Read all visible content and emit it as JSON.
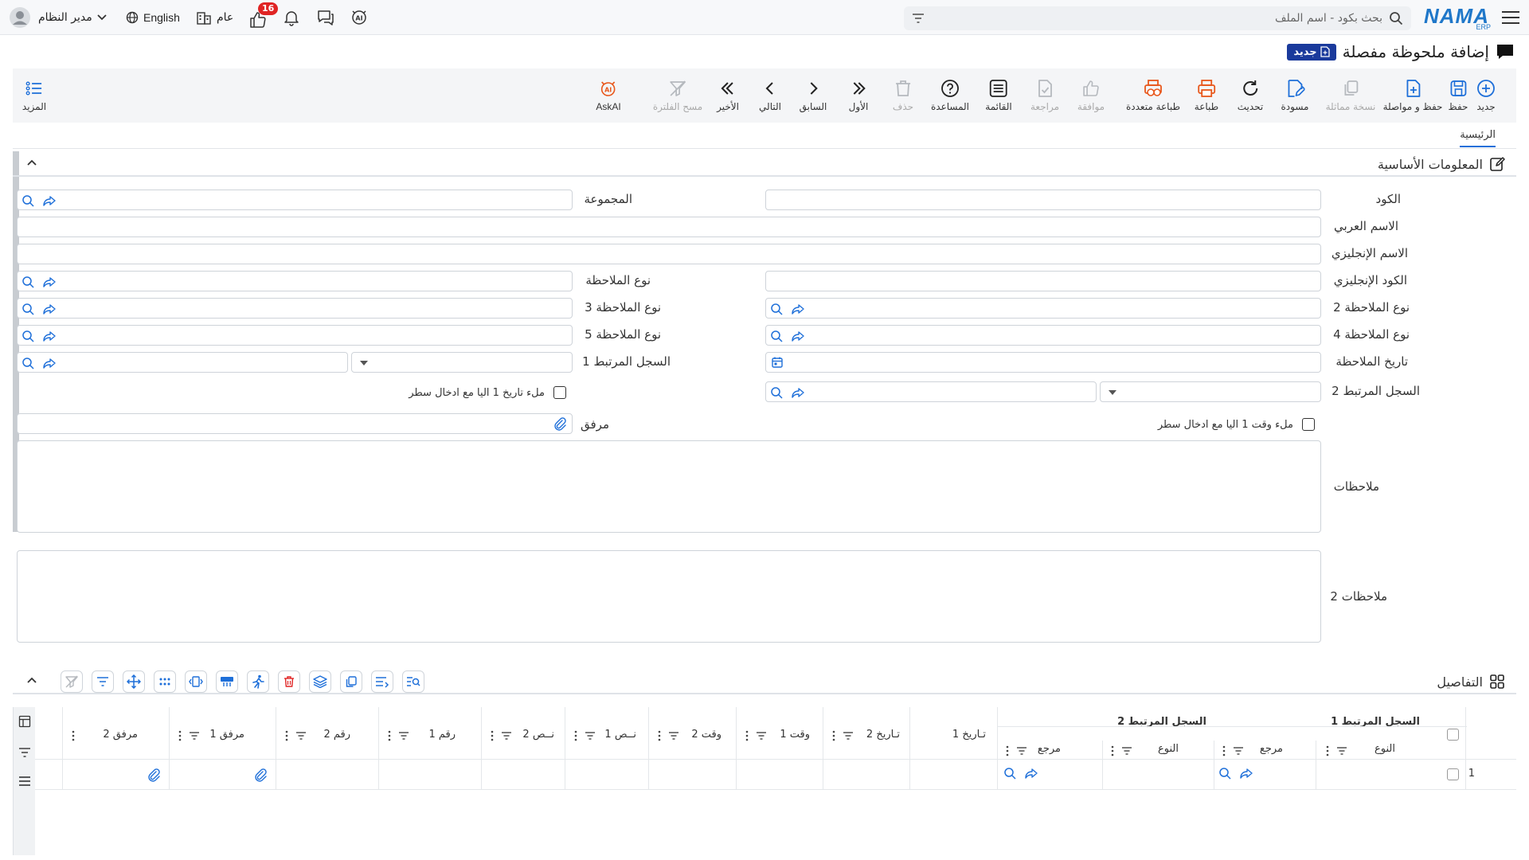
{
  "topbar": {
    "brand": "NAMA",
    "brand_sub": "ERP",
    "search_placeholder": "بحث بكود - اسم الملف",
    "user_name": "مدير النظام",
    "language": "English",
    "public_label": "عام",
    "notification_count": "16"
  },
  "page": {
    "title": "إضافة ملحوظة مفصلة",
    "badge": "جديد"
  },
  "toolbar": {
    "new": "جديد",
    "save": "حفظ",
    "save_continue": "حفظ و مواصلة",
    "duplicate": "نسخة مماثلة",
    "draft": "مسودة",
    "refresh": "تحديث",
    "print": "طباعة",
    "multi_print": "طباعة متعددة",
    "approve": "موافقة",
    "review": "مراجعة",
    "list": "القائمة",
    "help": "المساعدة",
    "delete": "حذف",
    "first": "الأول",
    "previous": "السابق",
    "next": "التالي",
    "last": "الأخير",
    "clear_filter": "مسح الفلترة",
    "askai": "AskAI",
    "more": "المزيد"
  },
  "tabs": {
    "main": "الرئيسية"
  },
  "basic_info": {
    "title": "المعلومات الأساسية",
    "code": "الكود",
    "group": "المجموعة",
    "arabic_name": "الاسم العربي",
    "english_name": "الاسم الإنجليزي",
    "english_code": "الكود الإنجليزي",
    "note_type": "نوع الملاحظة",
    "note_type_2": "نوع الملاحظة 2",
    "note_type_3": "نوع الملاحظة 3",
    "note_type_4": "نوع الملاحظة 4",
    "note_type_5": "نوع الملاحظة 5",
    "note_date": "تاريخ الملاحظة",
    "related_record_1": "السجل المرتبط 1",
    "related_record_2": "السجل المرتبط 2",
    "fill_date_auto": "ملء تاريخ 1 اليا مع ادخال سطر",
    "fill_time_auto": "ملء وقت 1 اليا مع ادخال سطر",
    "attachment": "مرفق",
    "notes": "ملاحظات",
    "notes_2": "ملاحظات 2"
  },
  "details": {
    "title": "التفاصيل",
    "group_1": "السجل المرتبط 1",
    "group_2": "السجل المرتبط 2",
    "columns": {
      "type": "النوع",
      "ref": "مرجع",
      "date1": "تـاريخ 1",
      "date2": "تـاريخ 2",
      "time1": "وقت 1",
      "time2": "وقت 2",
      "text1": "نــص 1",
      "text2": "نــص 2",
      "num1": "رقم 1",
      "num2": "رقم 2",
      "att1": "مرفق 1",
      "att2": "مرفق 2"
    },
    "row_number": "1"
  }
}
